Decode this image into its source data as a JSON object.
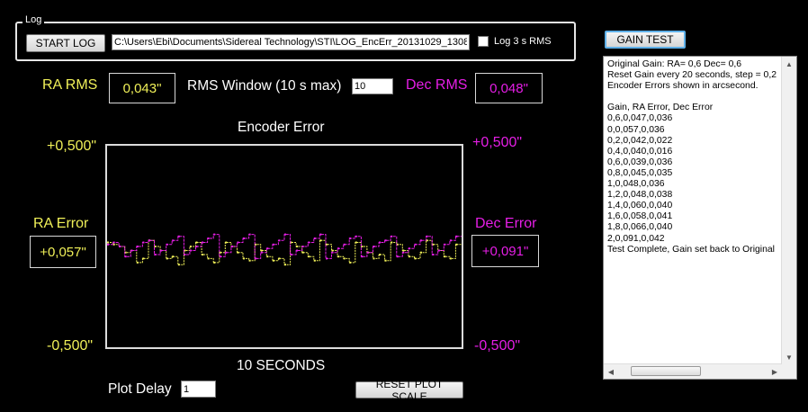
{
  "log": {
    "group_label": "Log",
    "start_button": "START LOG",
    "path_value": "C:\\Users\\Ebi\\Documents\\Sidereal Technology\\STI\\LOG_EncErr_20131029_1308",
    "checkbox_label": "Log 3 s RMS"
  },
  "gain_test_button": "GAIN TEST",
  "ra_rms": {
    "label": "RA RMS",
    "value": "0,043\""
  },
  "rms_window": {
    "label": "RMS Window (10 s max)",
    "value": "10"
  },
  "dec_rms": {
    "label": "Dec RMS",
    "value": "0,048\""
  },
  "plot": {
    "title": "Encoder Error",
    "xlabel": "10 SECONDS",
    "ra_top": "+0,500\"",
    "ra_bottom": "-0,500\"",
    "dec_top": "+0,500\"",
    "dec_bottom": "-0,500\"",
    "ra_error_label": "RA Error",
    "ra_error_value": "+0,057\"",
    "dec_error_label": "Dec Error",
    "dec_error_value": "+0,091\""
  },
  "plot_delay": {
    "label": "Plot Delay",
    "value": "1"
  },
  "reset_button": "RESET PLOT SCALE",
  "log_lines": [
    "Original Gain: RA= 0,6  Dec= 0,6",
    "Reset Gain every 20 seconds, step = 0,2",
    "Encoder Errors shown in arcsecond.",
    "",
    "Gain, RA Error, Dec Error",
    "0,6,0,047,0,036",
    "0,0,057,0,036",
    "0,2,0,042,0,022",
    "0,4,0,040,0,016",
    "0,6,0,039,0,036",
    "0,8,0,045,0,035",
    "1,0,048,0,036",
    "1,2,0,048,0,038",
    "1,4,0,060,0,040",
    "1,6,0,058,0,041",
    "1,8,0,066,0,040",
    "2,0,091,0,042",
    "Test Complete, Gain set back to Original"
  ],
  "colors": {
    "ra": "#f0f058",
    "dec": "#e61ee6",
    "background": "#000000"
  },
  "chart_data": {
    "type": "line",
    "title": "Encoder Error",
    "xlabel": "10 SECONDS",
    "ylim": [
      -0.5,
      0.5
    ],
    "series": [
      {
        "name": "RA Error",
        "color": "#f0f058",
        "values": [
          0.02,
          0.01,
          0.0,
          -0.03,
          -0.02,
          -0.08,
          -0.06,
          0.03,
          0.0,
          -0.02,
          -0.06,
          -0.05,
          -0.09,
          -0.02,
          0.0,
          0.02,
          -0.04,
          -0.06,
          -0.08,
          -0.03,
          0.02,
          0.0,
          -0.03,
          -0.06,
          -0.07,
          0.01,
          -0.02,
          -0.05,
          -0.07,
          -0.06,
          -0.09,
          0.02,
          0.0,
          -0.03,
          -0.05,
          -0.07,
          0.03,
          0.01,
          -0.02,
          -0.05,
          -0.06,
          -0.08,
          0.02,
          0.0,
          -0.03,
          -0.06,
          -0.04,
          -0.07,
          0.02,
          0.01,
          -0.02,
          -0.05,
          -0.06,
          -0.03,
          0.03,
          0.01,
          -0.02,
          -0.05,
          -0.06,
          0.01
        ]
      },
      {
        "name": "Dec Error",
        "color": "#e61ee6",
        "values": [
          0.01,
          0.02,
          0.0,
          -0.05,
          -0.02,
          0.0,
          0.02,
          0.03,
          -0.04,
          -0.02,
          0.01,
          0.03,
          0.05,
          -0.04,
          -0.02,
          0.0,
          0.02,
          0.04,
          0.06,
          -0.05,
          -0.03,
          0.0,
          0.02,
          0.04,
          0.06,
          -0.06,
          -0.03,
          -0.01,
          0.01,
          0.03,
          0.06,
          -0.04,
          -0.02,
          0.0,
          0.02,
          0.04,
          0.06,
          -0.06,
          -0.03,
          -0.01,
          0.01,
          0.04,
          0.05,
          -0.05,
          -0.03,
          0.0,
          0.02,
          0.03,
          0.05,
          -0.05,
          -0.03,
          -0.01,
          0.01,
          0.03,
          0.05,
          -0.04,
          -0.02,
          0.01,
          0.03,
          0.05
        ]
      }
    ]
  }
}
